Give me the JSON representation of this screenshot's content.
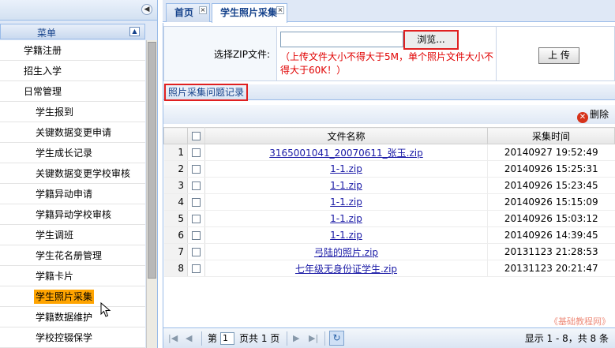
{
  "sidebar": {
    "title": "菜单",
    "items": [
      {
        "label": "学籍注册",
        "level": "top",
        "active": false
      },
      {
        "label": "招生入学",
        "level": "top",
        "active": false
      },
      {
        "label": "日常管理",
        "level": "top",
        "active": false
      },
      {
        "label": "学生报到",
        "level": "sub",
        "active": false
      },
      {
        "label": "关键数据变更申请",
        "level": "sub",
        "active": false
      },
      {
        "label": "学生成长记录",
        "level": "sub",
        "active": false
      },
      {
        "label": "关键数据变更学校审核",
        "level": "sub",
        "active": false
      },
      {
        "label": "学籍异动申请",
        "level": "sub",
        "active": false
      },
      {
        "label": "学籍异动学校审核",
        "level": "sub",
        "active": false
      },
      {
        "label": "学生调班",
        "level": "sub",
        "active": false
      },
      {
        "label": "学生花名册管理",
        "level": "sub",
        "active": false
      },
      {
        "label": "学籍卡片",
        "level": "sub",
        "active": false
      },
      {
        "label": "学生照片采集",
        "level": "sub",
        "active": true
      },
      {
        "label": "学籍数据维护",
        "level": "sub",
        "active": false
      },
      {
        "label": "学校控辍保学",
        "level": "sub",
        "active": false
      }
    ]
  },
  "tabs": [
    {
      "label": "首页",
      "active": false
    },
    {
      "label": "学生照片采集",
      "active": true
    }
  ],
  "upload": {
    "label": "选择ZIP文件:",
    "file_value": "",
    "browse_label": "浏览...",
    "note": "（上传文件大小不得大于5M，单个照片文件大小不得大于60K！）",
    "upload_label": "上 传"
  },
  "records": {
    "title": "照片采集问题记录",
    "delete_label": "删除",
    "columns": {
      "filename": "文件名称",
      "time": "采集时间"
    },
    "rows": [
      {
        "num": "1",
        "filename": "3165001041_20070611_张玉.zip",
        "time": "20140927 19:52:49"
      },
      {
        "num": "2",
        "filename": "1-1.zip",
        "time": "20140926 15:25:31"
      },
      {
        "num": "3",
        "filename": "1-1.zip",
        "time": "20140926 15:23:45"
      },
      {
        "num": "4",
        "filename": "1-1.zip",
        "time": "20140926 15:15:09"
      },
      {
        "num": "5",
        "filename": "1-1.zip",
        "time": "20140926 15:03:12"
      },
      {
        "num": "6",
        "filename": "1-1.zip",
        "time": "20140926 14:39:45"
      },
      {
        "num": "7",
        "filename": "弓陆的照片.zip",
        "time": "20131123 21:28:53"
      },
      {
        "num": "8",
        "filename": "七年级无身份证学生.zip",
        "time": "20131123 20:21:47"
      }
    ]
  },
  "pager": {
    "page_prefix": "第",
    "page_value": "1",
    "page_suffix": "页共 1 页",
    "status": "显示 1 - 8，共 8 条"
  },
  "watermark": "《基础教程网》",
  "colors": {
    "accent": "#15428b",
    "active_item": "#ffa400",
    "warning": "#e00000",
    "highlight_border": "#e02020"
  }
}
